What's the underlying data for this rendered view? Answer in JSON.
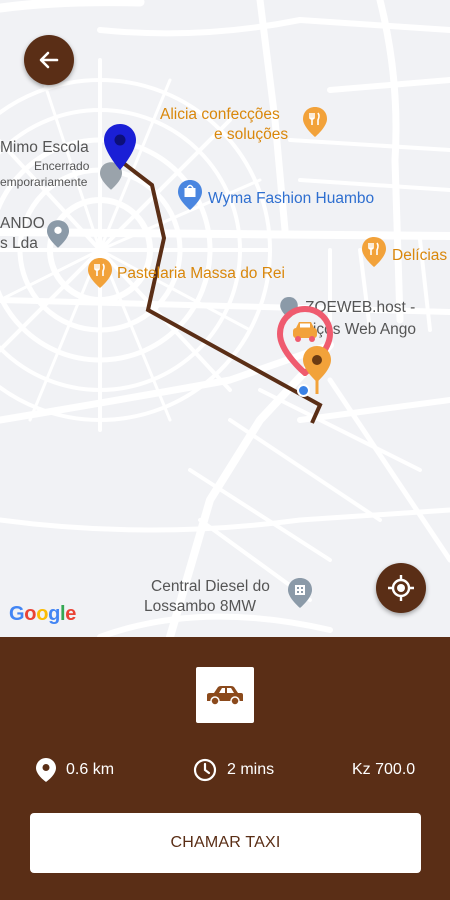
{
  "map": {
    "pois": {
      "alicia_line1": "Alicia confecções",
      "alicia_line2": "e soluções",
      "mimo_name": "Mimo Escola",
      "mimo_status_line1": "Encerrado",
      "mimo_status_line2": "emporariamente",
      "ando_line1": "ANDO",
      "ando_line2": "s Lda",
      "wyma": "Wyma Fashion Huambo",
      "delicias": "Delícias",
      "pastelaria": "Pastelaria Massa do Rei",
      "zoeweb_line1": "ZOEWEB.host -",
      "zoeweb_line2": "rviços Web Ango",
      "central_line1": "Central Diesel do",
      "central_line2": "Lossambo 8MW"
    },
    "google_logo": "Google",
    "back_icon": "arrow-left-icon",
    "locate_icon": "my-location-icon"
  },
  "panel": {
    "vehicle_icon": "car-icon",
    "distance": "0.6 km",
    "duration": "2 mins",
    "price": "Kz 700.0",
    "call_button": "CHAMAR TAXI"
  },
  "colors": {
    "brand": "#5a2e16",
    "route": "#5a2e16",
    "poi_orange": "#d9870b",
    "poi_blue": "#2f6fd0",
    "origin_pin": "#1a1fd6",
    "destination_pin": "#f2a23a"
  }
}
